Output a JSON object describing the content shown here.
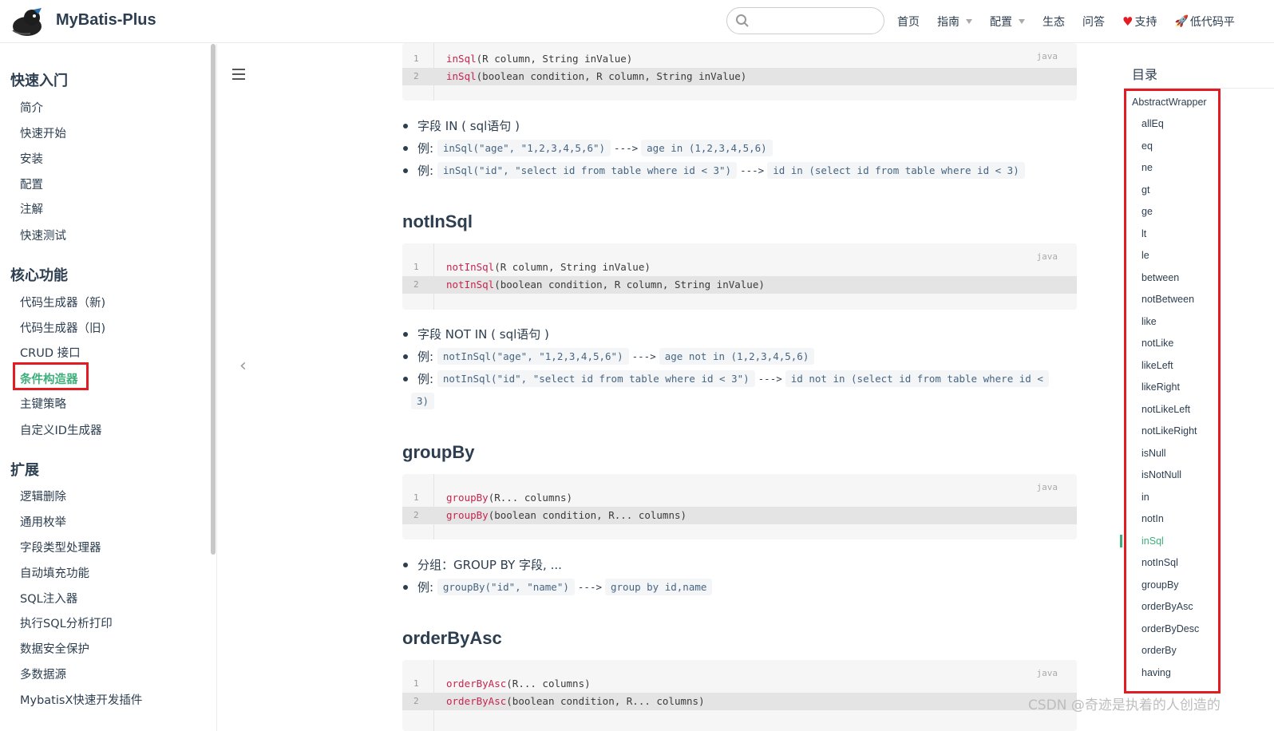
{
  "navbar": {
    "site_name": "MyBatis-Plus",
    "search_placeholder": "",
    "links": [
      {
        "label": "首页",
        "dropdown": false
      },
      {
        "label": "指南",
        "dropdown": true
      },
      {
        "label": "配置",
        "dropdown": true
      },
      {
        "label": "生态",
        "dropdown": false
      },
      {
        "label": "问答",
        "dropdown": false
      },
      {
        "label": "支持",
        "icon": "heart-icon"
      },
      {
        "label": "低代码平",
        "icon": "rocket-icon"
      }
    ]
  },
  "sidebar": {
    "groups": [
      {
        "title": "快速入门",
        "items": [
          "简介",
          "快速开始",
          "安装",
          "配置",
          "注解",
          "快速测试"
        ]
      },
      {
        "title": "核心功能",
        "items": [
          "代码生成器（新)",
          "代码生成器（旧)",
          "CRUD 接口",
          "条件构造器",
          "主键策略",
          "自定义ID生成器"
        ]
      },
      {
        "title": "扩展",
        "items": [
          "逻辑删除",
          "通用枚举",
          "字段类型处理器",
          "自动填充功能",
          "SQL注入器",
          "执行SQL分析打印",
          "数据安全保护",
          "多数据源",
          "MybatisX快速开发插件"
        ]
      }
    ],
    "active_item": "条件构造器"
  },
  "main": {
    "block1": {
      "lang": "java",
      "lines": [
        {
          "n": "1",
          "fn": "inSql",
          "args": "(R column, String inValue)"
        },
        {
          "n": "2",
          "fn": "inSql",
          "args": "(boolean condition, R column, String inValue)"
        }
      ],
      "bullets": {
        "b1": "字段 IN ( sql语句 )",
        "b2_label": "例:",
        "b2_code": "inSql(\"age\", \"1,2,3,4,5,6\")",
        "b2_arrow": "--->",
        "b2_result": "age in (1,2,3,4,5,6)",
        "b3_label": "例:",
        "b3_code": "inSql(\"id\", \"select id from table where id < 3\")",
        "b3_arrow": "--->",
        "b3_result": "id in (select id from table where id < 3)"
      }
    },
    "section_notInSql": {
      "title": "notInSql",
      "lang": "java",
      "lines": [
        {
          "n": "1",
          "fn": "notInSql",
          "args": "(R column, String inValue)"
        },
        {
          "n": "2",
          "fn": "notInSql",
          "args": "(boolean condition, R column, String inValue)"
        }
      ],
      "bullets": {
        "b1": "字段 NOT IN ( sql语句 )",
        "b2_label": "例:",
        "b2_code": "notInSql(\"age\", \"1,2,3,4,5,6\")",
        "b2_arrow": "--->",
        "b2_result": "age not in (1,2,3,4,5,6)",
        "b3_label": "例:",
        "b3_code": "notInSql(\"id\", \"select id from table where id < 3\")",
        "b3_arrow": "--->",
        "b3_result": "id not in (select id from table where id <",
        "b3_result_cont": "3)"
      }
    },
    "section_groupBy": {
      "title": "groupBy",
      "lang": "java",
      "lines": [
        {
          "n": "1",
          "fn": "groupBy",
          "args": "(R... columns)"
        },
        {
          "n": "2",
          "fn": "groupBy",
          "args": "(boolean condition, R... columns)"
        }
      ],
      "bullets": {
        "b1": "分组：GROUP BY 字段, ...",
        "b2_label": "例:",
        "b2_code": "groupBy(\"id\", \"name\")",
        "b2_arrow": "--->",
        "b2_result": "group by id,name"
      }
    },
    "section_orderByAsc": {
      "title": "orderByAsc",
      "lang": "java",
      "lines": [
        {
          "n": "1",
          "fn": "orderByAsc",
          "args": "(R... columns)"
        },
        {
          "n": "2",
          "fn": "orderByAsc",
          "args": "(boolean condition, R... columns)"
        }
      ]
    }
  },
  "toc": {
    "title": "目录",
    "root": "AbstractWrapper",
    "items": [
      "allEq",
      "eq",
      "ne",
      "gt",
      "ge",
      "lt",
      "le",
      "between",
      "notBetween",
      "like",
      "notLike",
      "likeLeft",
      "likeRight",
      "notLikeLeft",
      "notLikeRight",
      "isNull",
      "isNotNull",
      "in",
      "notIn",
      "inSql",
      "notInSql",
      "groupBy",
      "orderByAsc",
      "orderByDesc",
      "orderBy",
      "having"
    ],
    "active": "inSql"
  },
  "watermark": "CSDN @奇迹是执着的人创造的",
  "colors": {
    "accent": "#3eaf7c",
    "highlight_border": "#e31b23",
    "code_bg": "#f6f6f6"
  }
}
